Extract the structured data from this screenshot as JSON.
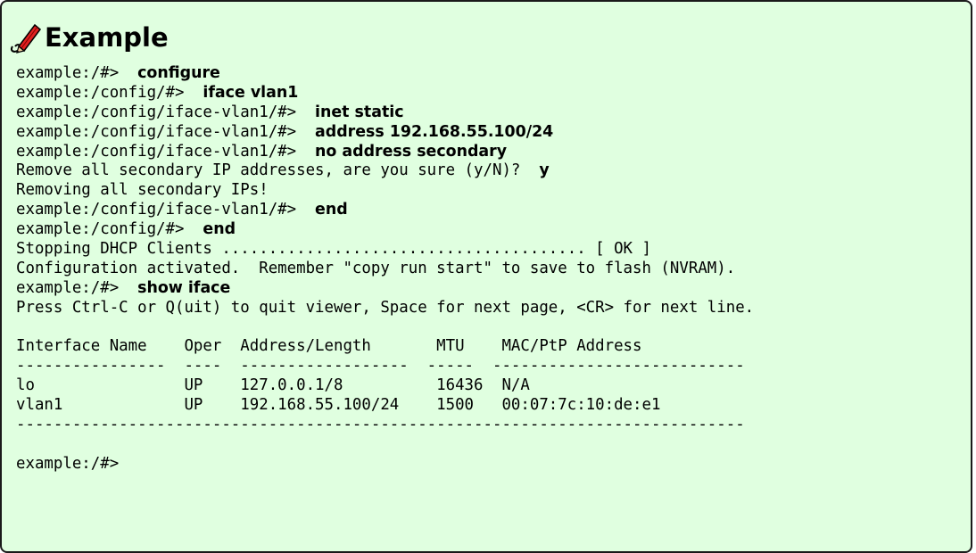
{
  "title": "Example",
  "icon": "pencil-icon",
  "colors": {
    "background": "#e0ffe0",
    "border": "#1a1a1a",
    "pencil_body": "#e02020",
    "pencil_tip": "#000000"
  },
  "lines": [
    {
      "prompt": "example:/#>  ",
      "command": "configure"
    },
    {
      "prompt": "example:/config/#>  ",
      "command": "iface vlan1"
    },
    {
      "prompt": "example:/config/iface-vlan1/#>  ",
      "command": "inet static"
    },
    {
      "prompt": "example:/config/iface-vlan1/#>  ",
      "command": "address 192.168.55.100/24"
    },
    {
      "prompt": "example:/config/iface-vlan1/#>  ",
      "command": "no address secondary"
    },
    {
      "prompt": "Remove all secondary IP addresses, are you sure (y/N)?  ",
      "command": "y"
    },
    {
      "prompt": "Removing all secondary IPs!",
      "command": ""
    },
    {
      "prompt": "example:/config/iface-vlan1/#>  ",
      "command": "end"
    },
    {
      "prompt": "example:/config/#>  ",
      "command": "end"
    },
    {
      "prompt": "Stopping DHCP Clients ....................................... [ OK ]",
      "command": ""
    },
    {
      "prompt": "Configuration activated.  Remember \"copy run start\" to save to flash (NVRAM).",
      "command": ""
    },
    {
      "prompt": "example:/#>  ",
      "command": "show iface"
    },
    {
      "prompt": "Press Ctrl-C or Q(uit) to quit viewer, Space for next page, <CR> for next line.",
      "command": ""
    },
    {
      "prompt": "",
      "command": ""
    },
    {
      "prompt": "Interface Name    Oper  Address/Length       MTU    MAC/PtP Address",
      "command": ""
    },
    {
      "prompt": "----------------  ----  ------------------  -----  ---------------------------",
      "command": ""
    },
    {
      "prompt": "lo                UP    127.0.0.1/8          16436  N/A",
      "command": ""
    },
    {
      "prompt": "vlan1             UP    192.168.55.100/24    1500   00:07:7c:10:de:e1",
      "command": ""
    },
    {
      "prompt": "------------------------------------------------------------------------------",
      "command": ""
    },
    {
      "prompt": "",
      "command": ""
    },
    {
      "prompt": "example:/#>",
      "command": ""
    }
  ]
}
